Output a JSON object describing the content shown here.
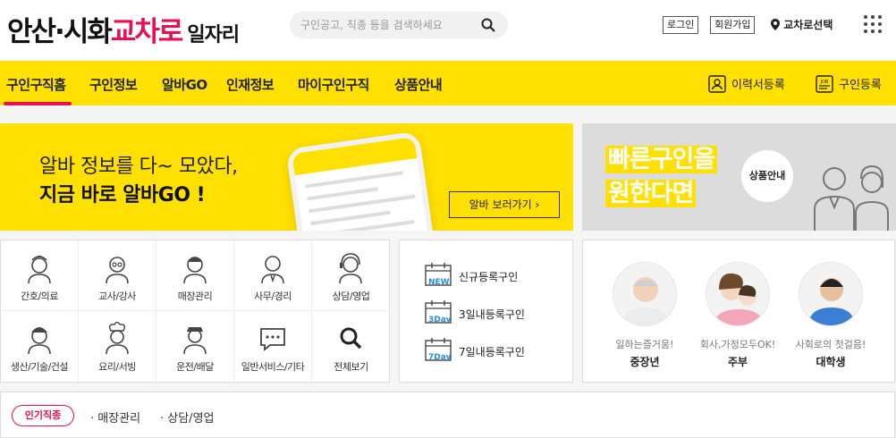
{
  "header": {
    "logo": {
      "part1": "안산·시화",
      "part2": "교차로",
      "part3": "일자리"
    },
    "search_placeholder": "구인공고, 직종 등을 검색하세요",
    "login": "로그인",
    "signup": "회원가입",
    "location": "교차로선택"
  },
  "nav": {
    "tabs": [
      "구인구직홈",
      "구인정보",
      "알바GO",
      "인재정보",
      "마이구인구직",
      "상품안내"
    ],
    "right": [
      "이력서등록",
      "구인등록"
    ]
  },
  "banner_alba": {
    "line1": "알바 정보를 다~ 모았다,",
    "line2": "지금 바로 알바GO !",
    "button": "알바 보러가기"
  },
  "banner_quick": {
    "line1": "빠른구인을",
    "line2": "원한다면",
    "button": "상품안내"
  },
  "categories": [
    {
      "label": "간호/의료",
      "icon": "nurse-icon"
    },
    {
      "label": "교사/강사",
      "icon": "teacher-icon"
    },
    {
      "label": "매장관리",
      "icon": "store-manager-icon"
    },
    {
      "label": "사무/경리",
      "icon": "office-worker-icon"
    },
    {
      "label": "상담/영업",
      "icon": "call-center-icon"
    },
    {
      "label": "생산/기술/건설",
      "icon": "construction-worker-icon"
    },
    {
      "label": "요리/서빙",
      "icon": "chef-icon"
    },
    {
      "label": "운전/배달",
      "icon": "driver-icon"
    },
    {
      "label": "일반서비스/기타",
      "icon": "chat-bubble-icon"
    },
    {
      "label": "전체보기",
      "icon": "search-icon"
    }
  ],
  "recent": [
    {
      "label": "신규등록구인",
      "badge": "NEW"
    },
    {
      "label": "3일내등록구인",
      "badge": "3Day"
    },
    {
      "label": "7일내등록구인",
      "badge": "7Day"
    }
  ],
  "groups": [
    {
      "caption": "일하는즐거움!",
      "name": "중장년"
    },
    {
      "caption": "회사,가정모두OK!",
      "name": "주부"
    },
    {
      "caption": "사회로의 첫걸음!",
      "name": "대학생"
    }
  ],
  "popular": {
    "tag": "인기직종",
    "items": [
      "· 매장관리",
      "· 상담/영업"
    ]
  },
  "colors": {
    "brand_pink": "#e8114f",
    "brand_yellow": "#ffe000",
    "badge_blue": "#2a8ee0"
  }
}
